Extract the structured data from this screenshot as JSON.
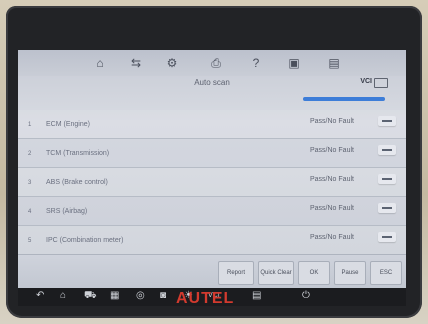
{
  "toolbar": {
    "icons": [
      "home-icon",
      "vehicle-swap-icon",
      "settings-icon",
      "print-icon",
      "help-icon",
      "save-icon",
      "data-icon"
    ],
    "glyphs": [
      "⌂",
      "⇆",
      "⚙",
      "⎙",
      "?",
      "▣",
      "▤"
    ]
  },
  "header": {
    "title": "Auto scan",
    "vci_label": "VCI"
  },
  "scan": {
    "progress": 1.0
  },
  "systems": [
    {
      "num": "1",
      "name": "ECM (Engine)",
      "status": "Pass/No Fault"
    },
    {
      "num": "2",
      "name": "TCM (Transmission)",
      "status": "Pass/No Fault"
    },
    {
      "num": "3",
      "name": "ABS (Brake control)",
      "status": "Pass/No Fault"
    },
    {
      "num": "4",
      "name": "SRS (Airbag)",
      "status": "Pass/No Fault"
    },
    {
      "num": "5",
      "name": "IPC (Combination meter)",
      "status": "Pass/No Fault"
    }
  ],
  "footer": {
    "buttons": {
      "report": "Report",
      "quick_clear": "Quick Clear",
      "ok": "OK",
      "pause": "Pause",
      "esc": "ESC"
    }
  },
  "navbar": {
    "icons": [
      "back-icon",
      "home-icon",
      "car-icon",
      "apps-icon",
      "browser-icon",
      "camera-icon",
      "brightness-icon",
      "vci-icon",
      "shop-icon",
      "power-icon"
    ],
    "glyphs": [
      "↶",
      "⌂",
      "⛟",
      "▦",
      "◎",
      "◙",
      "☀",
      "VCI",
      "▤",
      "⏻"
    ]
  },
  "brand": "AUTEL"
}
